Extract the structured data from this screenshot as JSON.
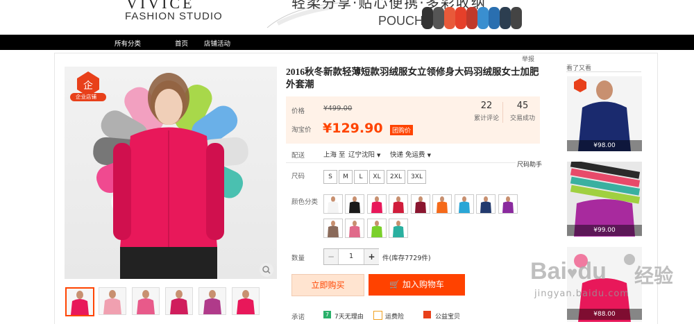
{
  "banner": {
    "brand_partial": "VIVICE",
    "brand": "FASHION STUDIO",
    "slogan": "轻柔分享·贴心便携·多彩收纳",
    "pouch_label": "POUCH",
    "pouch_colors": [
      "#333333",
      "#555555",
      "#e85a3a",
      "#e6402a",
      "#c0392b",
      "#3a8fd0",
      "#2a6fb0",
      "#2c3e50",
      "#444444"
    ]
  },
  "nav": {
    "items": [
      "所有分类",
      "首页",
      "店铺活动"
    ]
  },
  "report_label": "举报",
  "product": {
    "title": "2016秋冬新款轻薄短款羽绒服女立领修身大码羽绒服女士加肥外套潮",
    "badge_text": "企业店铺",
    "price_label": "价格",
    "original_price": "¥499.00",
    "taobao_label": "淘宝价",
    "current_price": "¥129.90",
    "tuan_label": "团购价",
    "reviews_count": "22",
    "reviews_label": "累计评论",
    "sales_count": "45",
    "sales_label": "交易成功",
    "shipping_label": "配送",
    "shipping_from": "上海 至",
    "shipping_to": "辽宁沈阳",
    "shipping_method": "快递 免运费",
    "size_helper": "尺码助手",
    "size_label": "尺码",
    "sizes": [
      "S",
      "M",
      "L",
      "XL",
      "2XL",
      "3XL"
    ],
    "color_label": "颜色分类",
    "color_swatches": [
      "#f4f4f4",
      "#1a1a1a",
      "#e8185a",
      "#d01d3c",
      "#8a1630",
      "#f56a1a",
      "#2aa6d6",
      "#223a6e",
      "#8a2a9e",
      "#8a6a5a",
      "#e06a8a",
      "#7ad02a",
      "#2ab0a0"
    ],
    "qty_label": "数量",
    "qty_value": "1",
    "qty_minus": "−",
    "qty_plus": "+",
    "stock_text": "件(库存7729件)",
    "buy_now": "立即购买",
    "add_to_cart": "加入购物车",
    "promise_label": "承诺",
    "promise_1": "7天无理由",
    "promise_2": "运费险",
    "promise_3": "公益宝贝",
    "thumb_colors": [
      "#e8185a",
      "#f0a0b0",
      "#e85a8a",
      "#d01d5c",
      "#b03a8a",
      "#e8185a"
    ]
  },
  "sidebar": {
    "title": "看了又看",
    "items": [
      {
        "price": "¥98.00",
        "color": "#1a2a6e"
      },
      {
        "price": "¥99.00",
        "color": "#a82a9e"
      },
      {
        "price": "¥88.00",
        "color": "#e8185a"
      }
    ]
  },
  "watermark": {
    "brand": "Bai",
    "brand_mid": "du",
    "cn": "经验",
    "url": "jingyan.baidu.com"
  }
}
